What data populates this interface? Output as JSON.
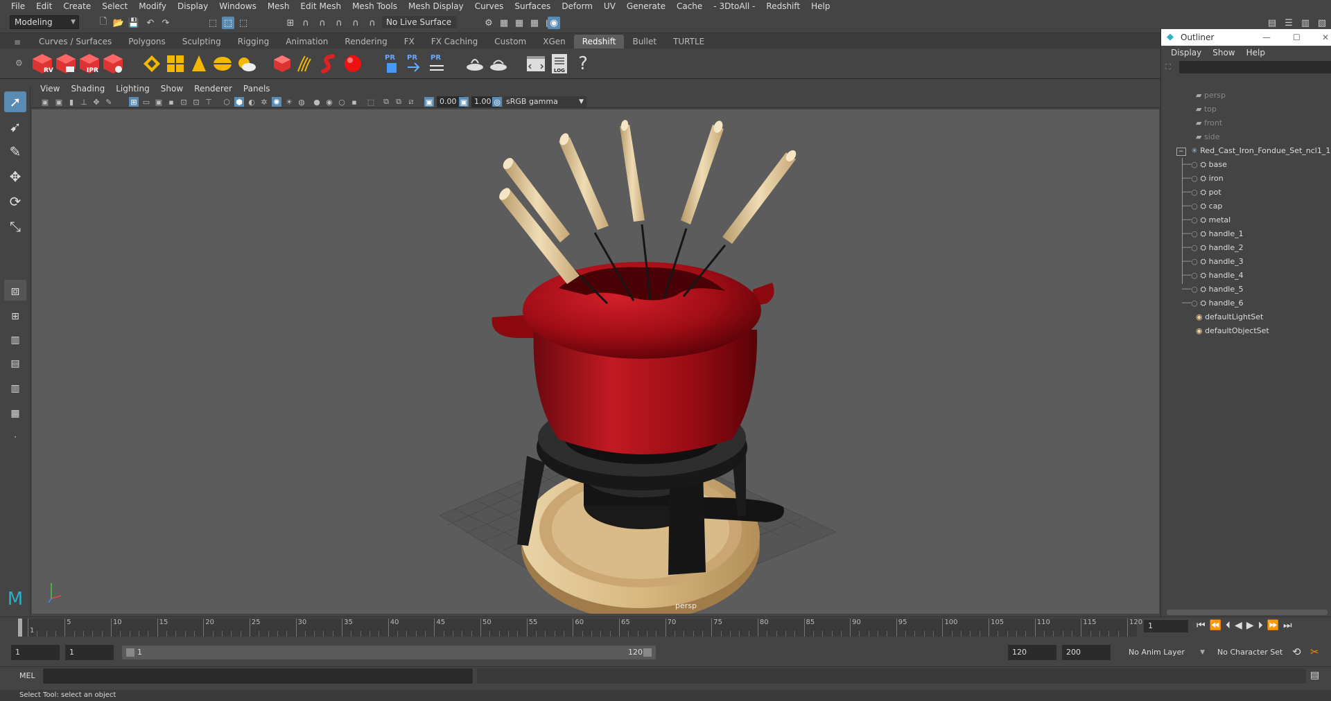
{
  "menu": [
    "File",
    "Edit",
    "Create",
    "Select",
    "Modify",
    "Display",
    "Windows",
    "Mesh",
    "Edit Mesh",
    "Mesh Tools",
    "Mesh Display",
    "Curves",
    "Surfaces",
    "Deform",
    "UV",
    "Generate",
    "Cache",
    "- 3DtoAll -",
    "Redshift",
    "Help"
  ],
  "status": {
    "mode": "Modeling",
    "live_surface": "No Live Surface"
  },
  "shelf_tabs": [
    "Curves / Surfaces",
    "Polygons",
    "Sculpting",
    "Rigging",
    "Animation",
    "Rendering",
    "FX",
    "FX Caching",
    "Custom",
    "XGen",
    "Redshift",
    "Bullet",
    "TURTLE"
  ],
  "active_shelf_tab": "Redshift",
  "shelf_labels": {
    "rv": "RV",
    "ipr": "IPR",
    "pr1": "PR",
    "pr2": "PR",
    "pr3": "PR",
    "log": "LOG"
  },
  "viewport_menu": [
    "View",
    "Shading",
    "Lighting",
    "Show",
    "Renderer",
    "Panels"
  ],
  "viewport_toolbar": {
    "exposure": "0.00",
    "gamma": "1.00",
    "colorspace": "sRGB gamma"
  },
  "camera_label": "persp",
  "outliner": {
    "title": "Outliner",
    "menu": [
      "Display",
      "Show",
      "Help"
    ],
    "cameras": [
      "persp",
      "top",
      "front",
      "side"
    ],
    "root": "Red_Cast_Iron_Fondue_Set_ncl1_1",
    "children": [
      "base",
      "iron",
      "pot",
      "cap",
      "metal",
      "handle_1",
      "handle_2",
      "handle_3",
      "handle_4",
      "handle_5",
      "handle_6"
    ],
    "sets": [
      "defaultLightSet",
      "defaultObjectSet"
    ]
  },
  "timeline": {
    "ticks": [
      "1",
      "5",
      "10",
      "15",
      "20",
      "25",
      "30",
      "35",
      "40",
      "45",
      "50",
      "55",
      "60",
      "65",
      "70",
      "75",
      "80",
      "85",
      "90",
      "95",
      "100",
      "105",
      "110",
      "115",
      "120"
    ],
    "current": "1"
  },
  "range": {
    "start": "1",
    "inner_start": "1",
    "slider_start": "1",
    "slider_end": "120",
    "end": "120",
    "max": "200",
    "anim_layer": "No Anim Layer",
    "char_set": "No Character Set"
  },
  "mel": {
    "label": "MEL"
  },
  "help_line": "Select Tool: select an object"
}
